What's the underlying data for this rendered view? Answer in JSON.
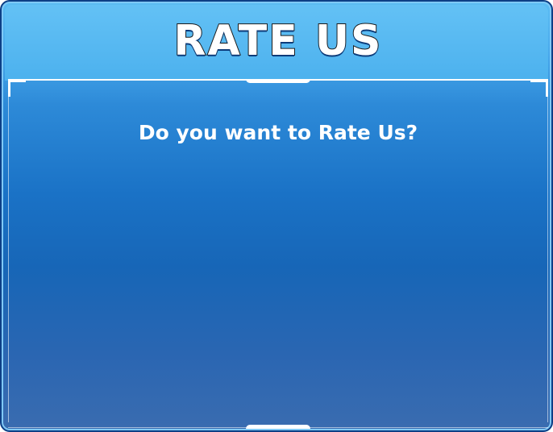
{
  "dialog": {
    "title": "RATE US",
    "message": "Do you want to Rate Us?"
  },
  "colors": {
    "header_top": "#63c1f5",
    "body_mid": "#1766b7",
    "border": "#0d3f86",
    "title_outline": "#1a1a1a",
    "text": "#ffffff"
  }
}
